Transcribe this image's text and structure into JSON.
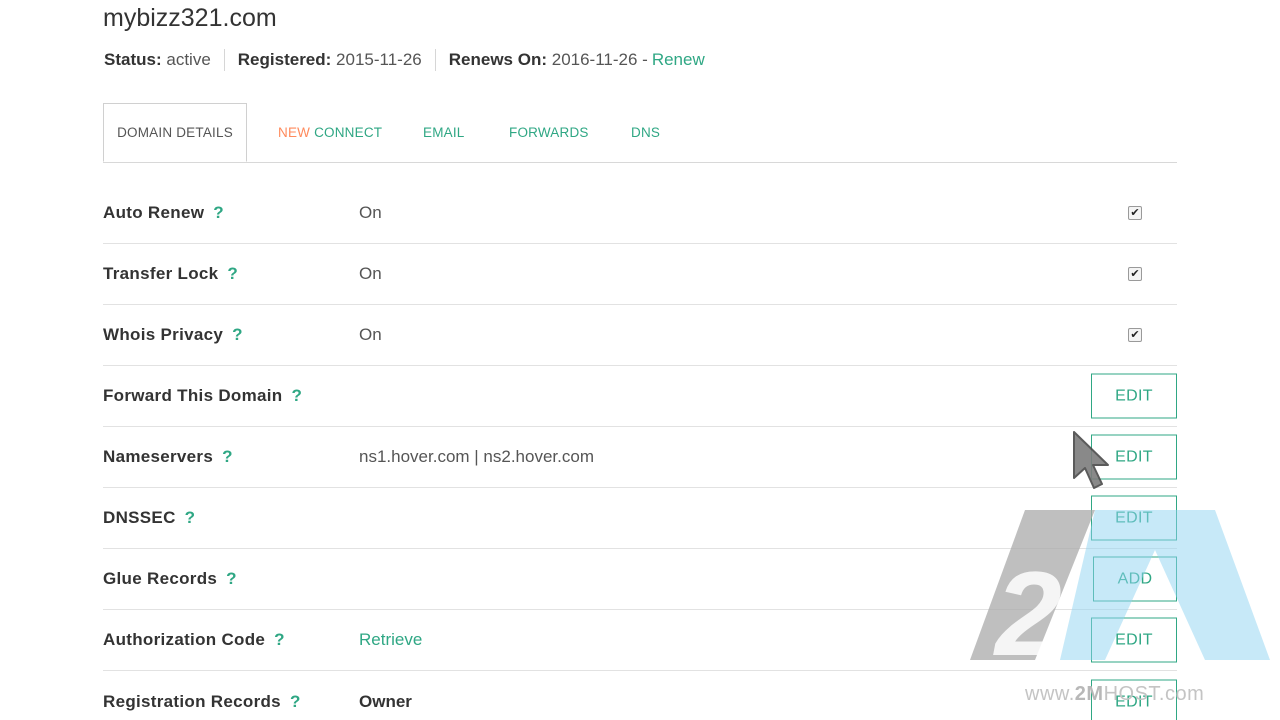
{
  "header": {
    "domain": "mybizz321.com",
    "status_label": "Status:",
    "status_value": "active",
    "registered_label": "Registered:",
    "registered_value": "2015-11-26",
    "renews_label": "Renews On:",
    "renews_value": "2016-11-26 -",
    "renew_link": "Renew"
  },
  "tabs": [
    {
      "label": "DOMAIN DETAILS",
      "active": true
    },
    {
      "badge": "NEW",
      "label": "CONNECT"
    },
    {
      "label": "EMAIL"
    },
    {
      "label": "FORWARDS"
    },
    {
      "label": "DNS"
    }
  ],
  "rows": [
    {
      "label": "Auto Renew",
      "help": "?",
      "value": "On",
      "checked": "✔"
    },
    {
      "label": "Transfer Lock",
      "help": "?",
      "value": "On",
      "checked": "✔"
    },
    {
      "label": "Whois Privacy",
      "help": "?",
      "value": "On",
      "checked": "✔"
    },
    {
      "label": "Forward This Domain",
      "help": "?",
      "button": "EDIT"
    },
    {
      "label": "Nameservers",
      "help": "?",
      "value": "ns1.hover.com | ns2.hover.com",
      "button": "EDIT"
    },
    {
      "label": "DNSSEC",
      "help": "?",
      "button": "EDIT"
    },
    {
      "label": "Glue Records",
      "help": "?",
      "button": "ADD"
    },
    {
      "label": "Authorization Code",
      "help": "?",
      "value": "Retrieve",
      "button": "EDIT"
    },
    {
      "label": "Registration Records",
      "help": "?",
      "value": "Owner",
      "button": "EDIT"
    }
  ],
  "watermark": {
    "prefix": "www.",
    "brand": "2M",
    "suffix": "HOST.com"
  },
  "colors": {
    "accent": "#2fa784",
    "new_badge": "#ff8a5c",
    "text": "#333333"
  }
}
